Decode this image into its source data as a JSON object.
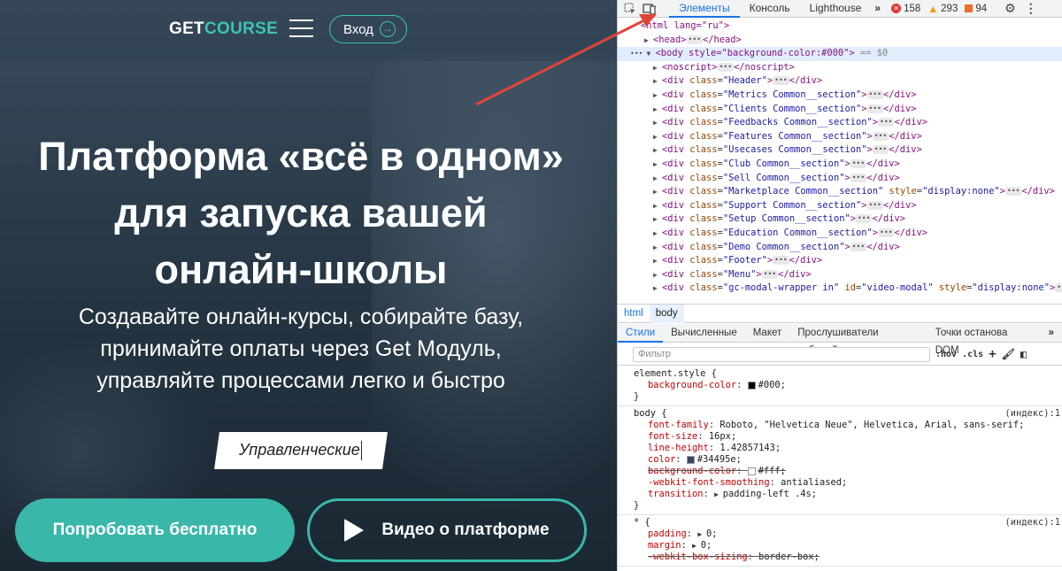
{
  "site": {
    "logo_part1": "GET",
    "logo_part2": "COURSE",
    "login_label": "Вход",
    "hero_title_lines": [
      "Платформа «всё в одном»",
      "для запуска вашей",
      "онлайн-школы"
    ],
    "hero_sub_lines": [
      "Создавайте онлайн-курсы, собирайте базу,",
      "принимайте оплаты через Get Модуль,",
      "управляйте процессами легко и быстро"
    ],
    "typed_tag": "Управленческие",
    "btn_try": "Попробовать бесплатно",
    "btn_video": "Видео о платформе",
    "colors": {
      "accent": "#3bc3b5",
      "hero_bg": "#2d3e4d"
    }
  },
  "devtools": {
    "tabs": [
      "Элементы",
      "Консоль",
      "Lighthouse"
    ],
    "active_tab": "Элементы",
    "more_tabs": "»",
    "errors": "158",
    "warnings": "293",
    "infos": "94",
    "dom": {
      "html_open": "<html lang=\"ru\">",
      "head": "<head>",
      "head_close": "</head>",
      "body_open": "<body style=\"background-color:#000\">",
      "body_eq": "== $0",
      "noscript": "<noscript>",
      "noscript_close": "</noscript>",
      "divs": [
        "Header",
        "Metrics Common__section",
        "Clients Common__section",
        "Feedbacks Common__section",
        "Features Common__section",
        "Usecases Common__section",
        "Club Common__section",
        "Sell Common__section",
        "Marketplace Common__section",
        "Support Common__section",
        "Setup Common__section",
        "Education Common__section",
        "Demo Common__section",
        "Footer",
        "Menu",
        "gc-modal-wrapper in"
      ],
      "marketplace_style": "display:none",
      "modal_id": "video-modal",
      "modal_style": "display:none"
    },
    "breadcrumbs": [
      "html",
      "body"
    ],
    "sub_tabs": [
      "Стили",
      "Вычисленные",
      "Макет",
      "Прослушиватели событий",
      "Точки останова DOM"
    ],
    "filter_placeholder": "Фильтр",
    "hov": ":hov",
    "cls": ".cls",
    "styles": {
      "element_style_sel": "element.style {",
      "element_style_prop": "background-color",
      "element_style_val": "#000;",
      "body_sel": "body {",
      "body_src": "(индекс):1",
      "body_props": [
        {
          "name": "font-family",
          "value": "Roboto, \"Helvetica Neue\", Helvetica, Arial, sans-serif;"
        },
        {
          "name": "font-size",
          "value": "16px;"
        },
        {
          "name": "line-height",
          "value": "1.42857143;"
        },
        {
          "name": "color",
          "value": "#34495e;"
        },
        {
          "name": "background-color",
          "value": "#fff;"
        },
        {
          "name": "-webkit-font-smoothing",
          "value": "antialiased;"
        },
        {
          "name": "transition",
          "value": "padding-left .4s;"
        }
      ],
      "close": "}",
      "star_sel": "* {",
      "star_src": "(индекс):1",
      "star_props": [
        {
          "name": "padding",
          "value": "0;"
        },
        {
          "name": "margin",
          "value": "0;"
        },
        {
          "name": "-webkit-box-sizing",
          "value": "border-box;"
        }
      ]
    }
  }
}
